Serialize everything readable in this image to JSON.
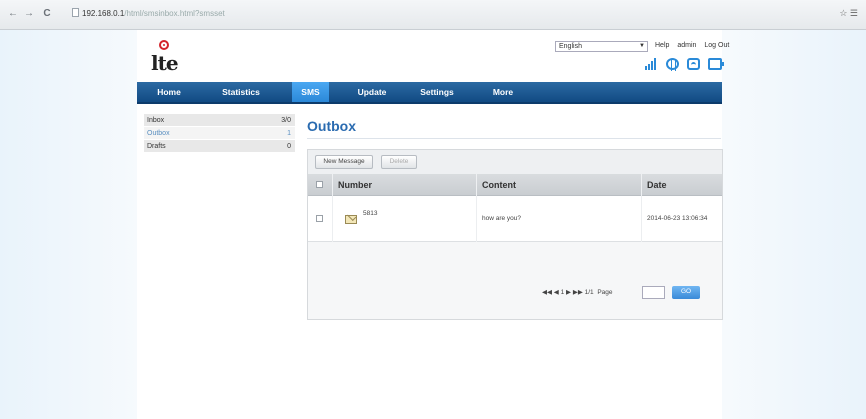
{
  "browser": {
    "back": "←",
    "forward": "→",
    "reload": "C",
    "url_host": "192.168.0.1",
    "url_path": "/html/smsinbox.html?smsset",
    "chrome_right": "☆ ☰"
  },
  "header": {
    "logo_text": "lte",
    "language": "English",
    "links": [
      "Help",
      "admin",
      "Log Out"
    ]
  },
  "mainnav": {
    "items": [
      "Home",
      "Statistics",
      "SMS",
      "Update",
      "Settings",
      "More"
    ],
    "active_index": 2
  },
  "sidebar": {
    "items": [
      {
        "label": "Inbox",
        "count": "3/0"
      },
      {
        "label": "Outbox",
        "count": "1"
      },
      {
        "label": "Drafts",
        "count": "0"
      }
    ],
    "active_index": 1
  },
  "content": {
    "title": "Outbox",
    "toolbar": {
      "new_message": "New Message",
      "delete": "Delete"
    },
    "columns": [
      "Number",
      "Content",
      "Date"
    ],
    "rows": [
      {
        "number": "5813",
        "content": "how are you?",
        "date": "2014-06-23 13:06:34"
      }
    ],
    "pager": {
      "controls": "◀◀ ◀ 1 ▶ ▶▶ 1/1",
      "page_label": "Page",
      "page_value": "",
      "go_label": "GO"
    }
  },
  "colors": {
    "nav": "#1b5a94",
    "nav_active": "#3a97e4",
    "title": "#2a6bb0",
    "status_icon": "#2a8ad8"
  },
  "icons": [
    "signal-icon",
    "globe-icon",
    "wifi-icon",
    "battery-icon",
    "mail-icon"
  ]
}
